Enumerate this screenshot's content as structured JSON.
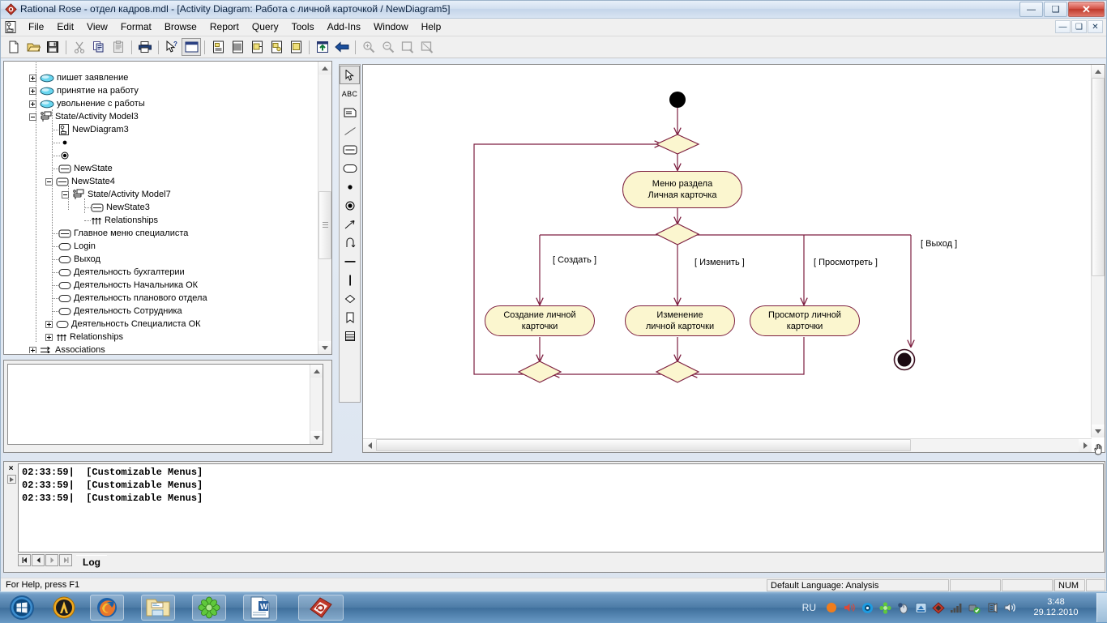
{
  "window": {
    "title": "Rational Rose - отдел кадров.mdl - [Activity Diagram: Работа с личной карточкой / NewDiagram5]",
    "app_icon": "rational-rose-icon",
    "buttons": {
      "minimize": "–",
      "restore": "❐",
      "close": "✕"
    }
  },
  "mdi_buttons": {
    "minimize": "–",
    "restore": "❐",
    "close": "✕"
  },
  "menu": {
    "items": [
      {
        "label": "File"
      },
      {
        "label": "Edit"
      },
      {
        "label": "View"
      },
      {
        "label": "Format"
      },
      {
        "label": "Browse"
      },
      {
        "label": "Report"
      },
      {
        "label": "Query"
      },
      {
        "label": "Tools"
      },
      {
        "label": "Add-Ins"
      },
      {
        "label": "Window"
      },
      {
        "label": "Help"
      }
    ]
  },
  "toolbar": {
    "buttons": [
      {
        "name": "new-icon",
        "glyph": "doc"
      },
      {
        "name": "open-icon",
        "glyph": "folder"
      },
      {
        "name": "save-icon",
        "glyph": "disk"
      },
      {
        "name": "separator",
        "glyph": "sep"
      },
      {
        "name": "cut-icon",
        "glyph": "scissors"
      },
      {
        "name": "copy-icon",
        "glyph": "copy"
      },
      {
        "name": "paste-icon",
        "glyph": "paste"
      },
      {
        "name": "separator",
        "glyph": "sep"
      },
      {
        "name": "print-icon",
        "glyph": "printer"
      },
      {
        "name": "separator",
        "glyph": "sep"
      },
      {
        "name": "context-help-icon",
        "glyph": "arrowq"
      },
      {
        "name": "browse-class-diagram-icon",
        "glyph": "window",
        "selected": true
      },
      {
        "name": "separator",
        "glyph": "sep"
      },
      {
        "name": "browse-use-case-icon",
        "glyph": "page1"
      },
      {
        "name": "browse-component-icon",
        "glyph": "page2"
      },
      {
        "name": "browse-state-icon",
        "glyph": "page3"
      },
      {
        "name": "browse-deployment-icon",
        "glyph": "page4"
      },
      {
        "name": "browse-parent-icon",
        "glyph": "page5"
      },
      {
        "name": "separator",
        "glyph": "sep"
      },
      {
        "name": "browse-previous-icon",
        "glyph": "upbox"
      },
      {
        "name": "back-icon",
        "glyph": "leftarrow"
      },
      {
        "name": "separator",
        "glyph": "sep"
      },
      {
        "name": "zoom-in-icon",
        "glyph": "zoomin",
        "disabled": true
      },
      {
        "name": "zoom-out-icon",
        "glyph": "zoomout",
        "disabled": true
      },
      {
        "name": "fit-in-window-icon",
        "glyph": "fit",
        "disabled": true
      },
      {
        "name": "undo-fit-icon",
        "glyph": "unfit",
        "disabled": true
      }
    ]
  },
  "toolbox": {
    "tools": [
      {
        "name": "selection-tool",
        "glyph": "pointer",
        "selected": true
      },
      {
        "name": "text-tool",
        "glyph": "ABC"
      },
      {
        "name": "note-tool",
        "glyph": "note"
      },
      {
        "name": "anchor-note-tool",
        "glyph": "line"
      },
      {
        "name": "state-tool",
        "glyph": "state"
      },
      {
        "name": "activity-tool",
        "glyph": "activity"
      },
      {
        "name": "start-state-tool",
        "glyph": "dot"
      },
      {
        "name": "end-state-tool",
        "glyph": "bullseye"
      },
      {
        "name": "state-transition-tool",
        "glyph": "arrow"
      },
      {
        "name": "transition-to-self-tool",
        "glyph": "loop"
      },
      {
        "name": "horizontal-synchronization-tool",
        "glyph": "hbar"
      },
      {
        "name": "vertical-synchronization-tool",
        "glyph": "vbar"
      },
      {
        "name": "decision-tool",
        "glyph": "diamond"
      },
      {
        "name": "swimlane-tool",
        "glyph": "swimlane"
      },
      {
        "name": "object-tool",
        "glyph": "object"
      }
    ]
  },
  "browser": {
    "tree": [
      {
        "label": "пишет заявление",
        "indent": 0,
        "toggle": "plus",
        "icon": "use-case-icon"
      },
      {
        "label": "принятие на работу",
        "indent": 0,
        "toggle": "plus",
        "icon": "use-case-icon"
      },
      {
        "label": "увольнение с работы",
        "indent": 0,
        "toggle": "plus",
        "icon": "use-case-icon"
      },
      {
        "label": "State/Activity Model3",
        "indent": 0,
        "toggle": "minus",
        "icon": "state-model-icon"
      },
      {
        "label": "NewDiagram3",
        "indent": 1,
        "toggle": "none",
        "icon": "activity-diagram-icon"
      },
      {
        "label": "",
        "indent": 1,
        "toggle": "none",
        "icon": "start-state-icon"
      },
      {
        "label": "",
        "indent": 1,
        "toggle": "none",
        "icon": "end-state-icon"
      },
      {
        "label": "NewState",
        "indent": 1,
        "toggle": "none",
        "icon": "state-icon"
      },
      {
        "label": "NewState4",
        "indent": 1,
        "toggle": "minus",
        "icon": "state-icon"
      },
      {
        "label": "State/Activity Model7",
        "indent": 2,
        "toggle": "minus",
        "icon": "state-model-icon"
      },
      {
        "label": "NewState3",
        "indent": 3,
        "toggle": "none",
        "icon": "state-icon"
      },
      {
        "label": "Relationships",
        "indent": 3,
        "toggle": "none",
        "icon": "relationships-icon"
      },
      {
        "label": "Главное меню специалиста",
        "indent": 1,
        "toggle": "none",
        "icon": "state-icon"
      },
      {
        "label": "Login",
        "indent": 1,
        "toggle": "none",
        "icon": "activity-icon"
      },
      {
        "label": "Выход",
        "indent": 1,
        "toggle": "none",
        "icon": "activity-icon"
      },
      {
        "label": "Деятельность бухгалтерии",
        "indent": 1,
        "toggle": "none",
        "icon": "activity-icon"
      },
      {
        "label": "Деятельность Начальника ОК",
        "indent": 1,
        "toggle": "none",
        "icon": "activity-icon"
      },
      {
        "label": "Деятельность планового отдела",
        "indent": 1,
        "toggle": "none",
        "icon": "activity-icon"
      },
      {
        "label": "Деятельность Сотрудника",
        "indent": 1,
        "toggle": "none",
        "icon": "activity-icon"
      },
      {
        "label": "Деятельность Специалиста ОК",
        "indent": 1,
        "toggle": "plus",
        "icon": "activity-icon"
      },
      {
        "label": "Relationships",
        "indent": 0,
        "toggle": "plus",
        "icon": "relationships-icon"
      },
      {
        "label": "Associations",
        "indent": 0,
        "toggle": "plus",
        "icon": "associations-icon"
      }
    ]
  },
  "diagram": {
    "nodes": [
      {
        "name": "start-state",
        "type": "start",
        "label": ""
      },
      {
        "name": "merge-decision-top",
        "type": "decision",
        "label": ""
      },
      {
        "name": "activity-menu",
        "type": "activity",
        "label": "Меню раздела\nЛичная карточка",
        "line1": "Меню раздела",
        "line2": "Личная карточка"
      },
      {
        "name": "branch-decision",
        "type": "decision",
        "label": ""
      },
      {
        "name": "activity-create",
        "type": "activity",
        "line1": "Создание  личной",
        "line2": "карточки"
      },
      {
        "name": "activity-edit",
        "type": "activity",
        "line1": "Изменение",
        "line2": "личной карточки"
      },
      {
        "name": "activity-view",
        "type": "activity",
        "line1": "Просмотр личной",
        "line2": "карточки"
      },
      {
        "name": "merge-decision-left",
        "type": "decision",
        "label": ""
      },
      {
        "name": "merge-decision-right",
        "type": "decision",
        "label": ""
      },
      {
        "name": "end-state",
        "type": "end",
        "label": ""
      }
    ],
    "guards": [
      {
        "name": "guard-create",
        "label": "[ Создать ]"
      },
      {
        "name": "guard-edit",
        "label": "[ Изменить ]"
      },
      {
        "name": "guard-view",
        "label": "[ Просмотреть ]"
      },
      {
        "name": "guard-exit",
        "label": "[ Выход ]"
      }
    ],
    "colors": {
      "fill": "#fbf6cf",
      "stroke": "#7d1f40"
    }
  },
  "log": {
    "close_glyph": "×",
    "lines": [
      "02:33:59|  [Customizable Menus]",
      "02:33:59|  [Customizable Menus]",
      "02:33:59|  [Customizable Menus]"
    ],
    "nav": [
      "|◀",
      "◀",
      "▶",
      "▶|"
    ],
    "tab": "Log"
  },
  "statusbar": {
    "hint": "For Help, press F1",
    "language": "Default Language: Analysis",
    "cell2": "",
    "cell3": "",
    "cell4": "",
    "num": "NUM",
    "cell6": ""
  },
  "taskbar": {
    "buttons": [
      {
        "name": "start-button",
        "glyph": "windows"
      },
      {
        "name": "taskbar-app-avast",
        "glyph": "avast"
      },
      {
        "name": "taskbar-app-firefox",
        "glyph": "firefox"
      },
      {
        "name": "taskbar-app-explorer",
        "glyph": "folder"
      },
      {
        "name": "taskbar-app-icq",
        "glyph": "icq"
      },
      {
        "name": "taskbar-app-word",
        "glyph": "word"
      },
      {
        "name": "taskbar-app-rational-rose",
        "glyph": "rose"
      }
    ],
    "tray": {
      "language": "RU",
      "icons": [
        "orange-dot-icon",
        "volume-icon",
        "shield-icon",
        "icq-icon",
        "mouse-icon",
        "update-icon",
        "avast-icon",
        "signal-icon",
        "usb-safe-icon",
        "network-icon",
        "speaker-icon"
      ],
      "time": "3:48",
      "date": "29.12.2010"
    }
  }
}
